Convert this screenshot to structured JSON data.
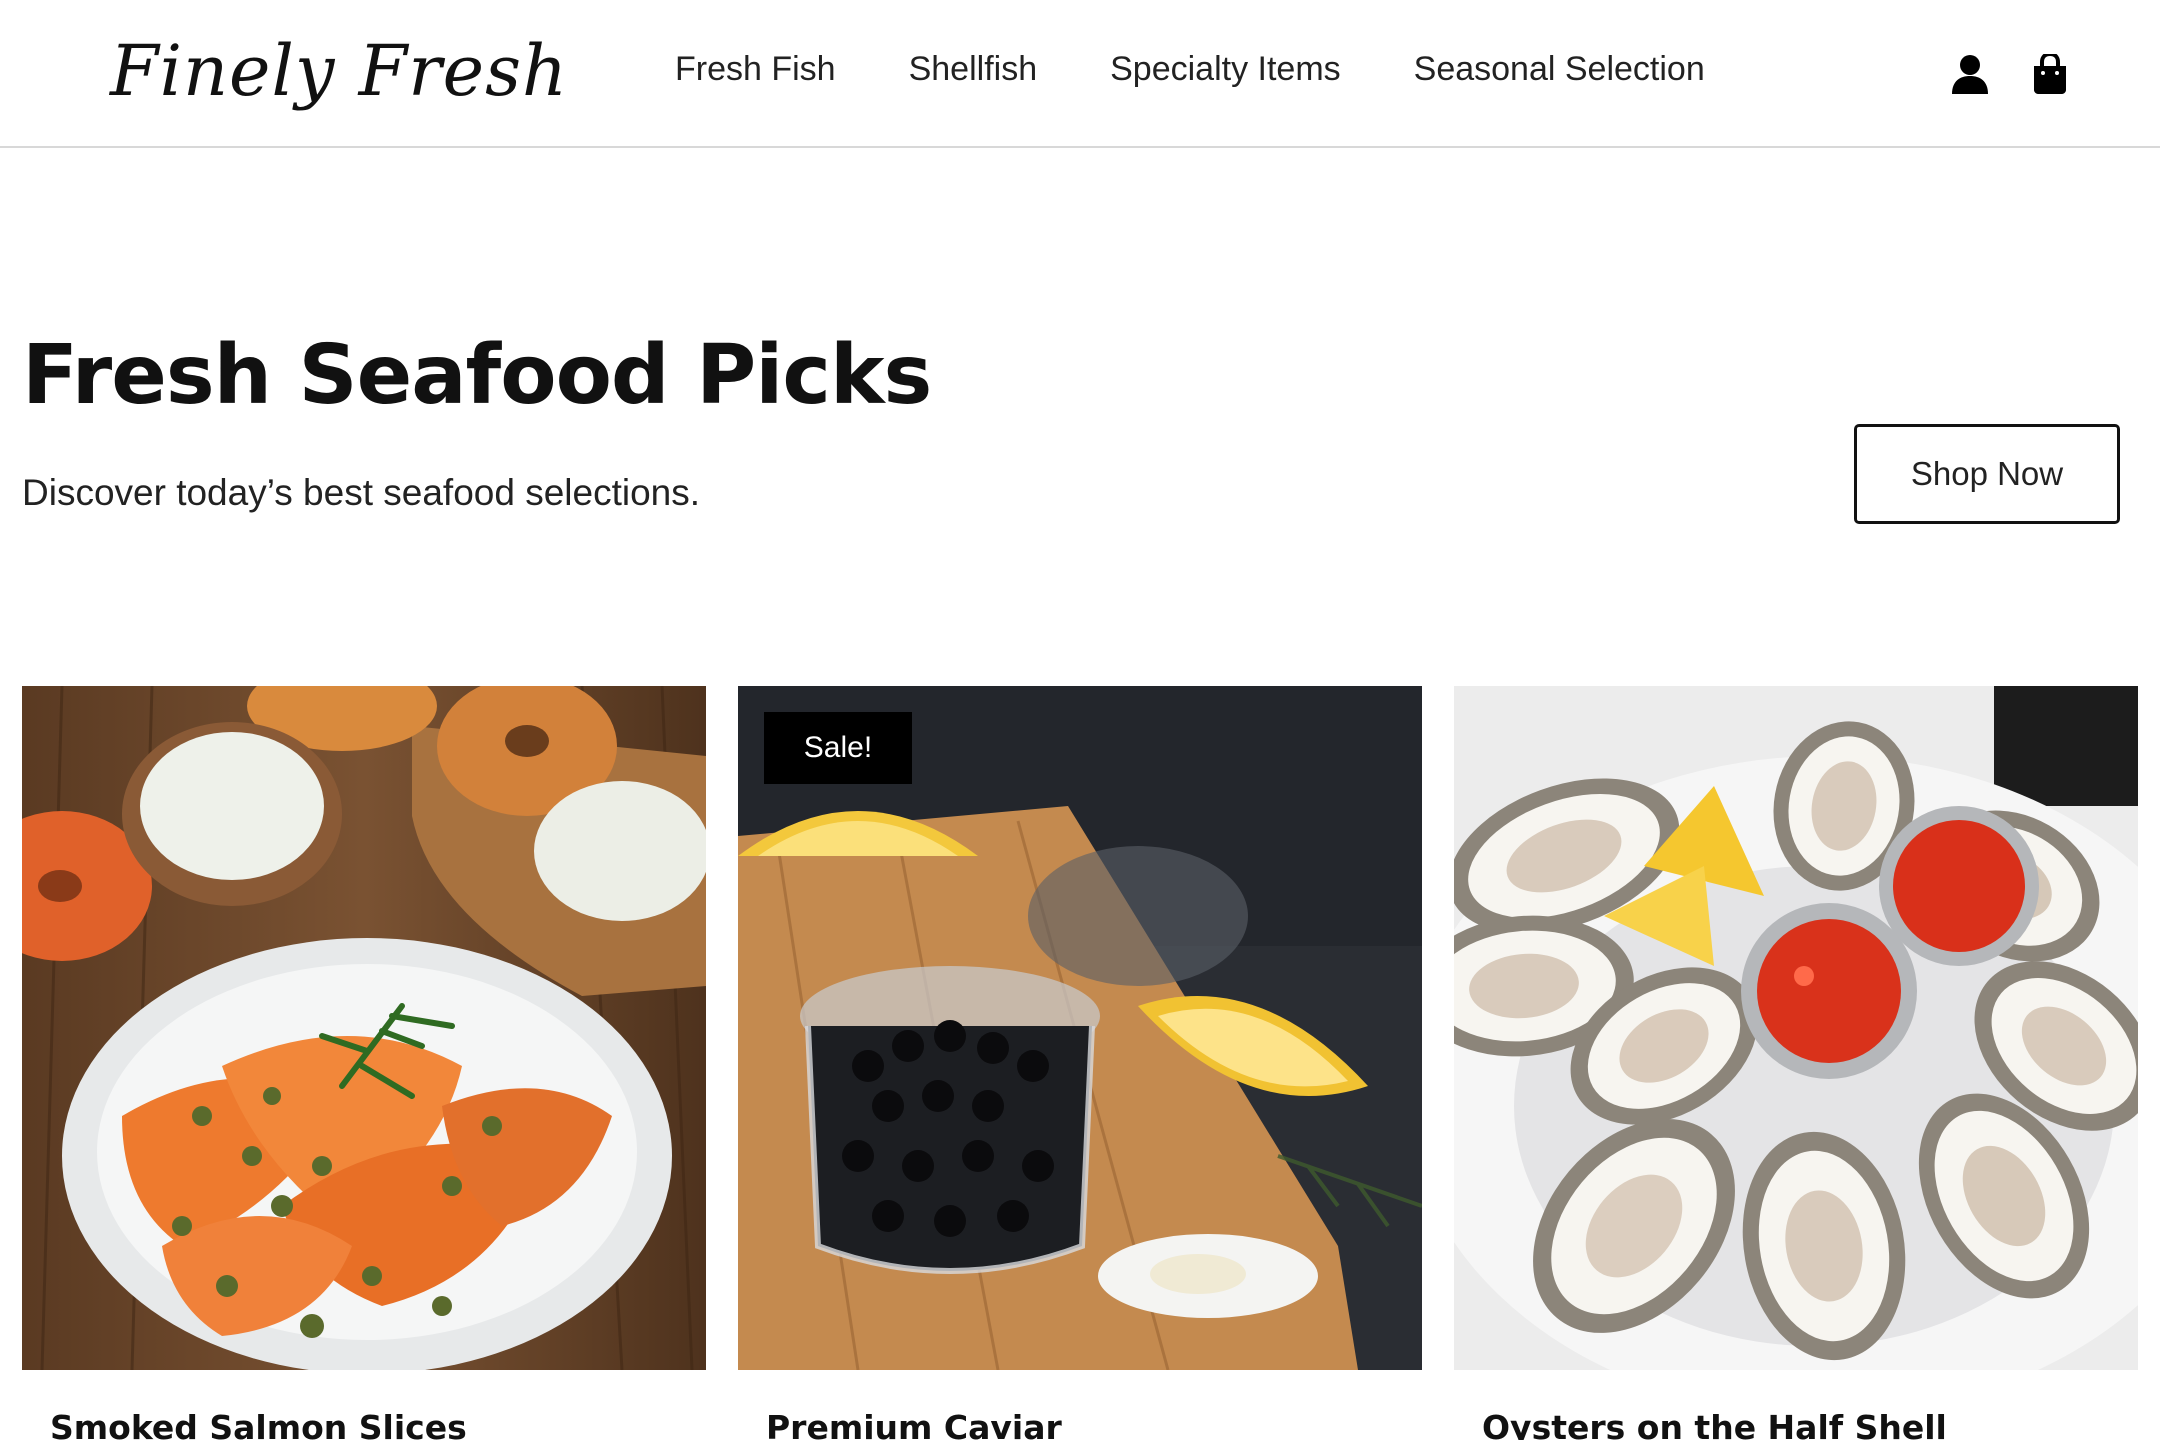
{
  "header": {
    "logo": "Finely Fresh",
    "nav": [
      "Fresh Fish",
      "Shellfish",
      "Specialty Items",
      "Seasonal Selection"
    ],
    "icons": [
      "account-icon",
      "shopping-bag-icon"
    ]
  },
  "hero": {
    "title": "Fresh Seafood Picks",
    "subtitle": "Discover today’s best seafood selections.",
    "cta": "Shop Now"
  },
  "products": [
    {
      "title": "Smoked Salmon Slices",
      "image": "smoked-salmon-plate-image"
    },
    {
      "title": "Premium Caviar",
      "image": "caviar-jar-image",
      "badge": "Sale!"
    },
    {
      "title": "Oysters on the Half Shell",
      "image": "oysters-platter-image"
    }
  ],
  "colors": {
    "text": "#111111",
    "badge_bg": "#000000",
    "badge_text": "#ffffff",
    "divider": "#d8d8d8"
  }
}
